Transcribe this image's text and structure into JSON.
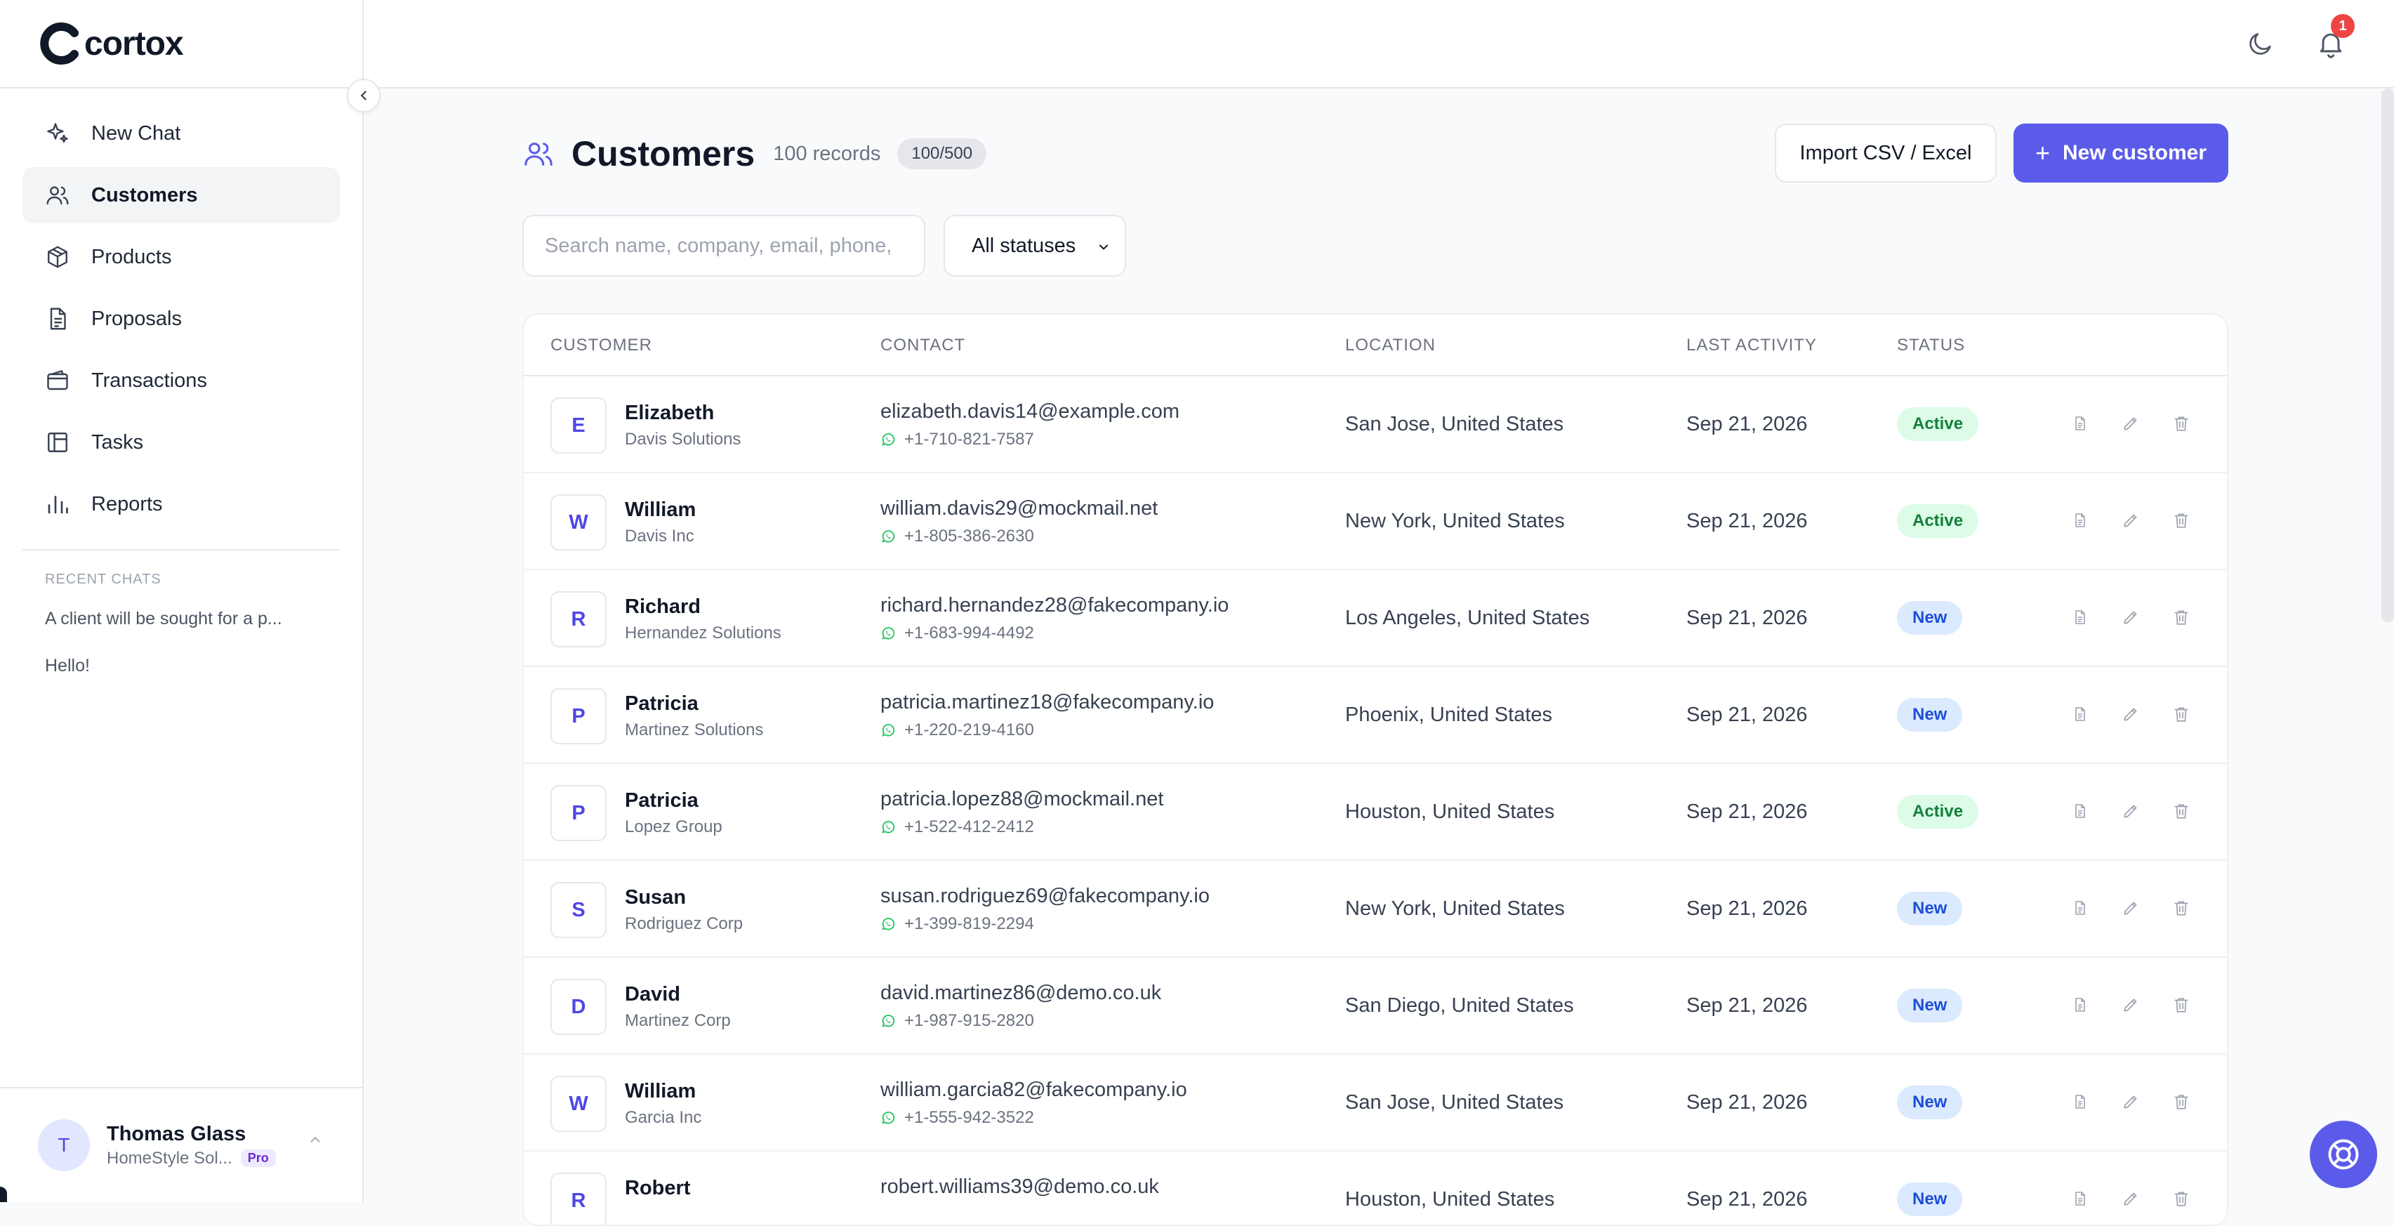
{
  "brand": {
    "name": "cortox"
  },
  "sidebar": {
    "items": [
      {
        "label": "New Chat",
        "icon": "sparkle-icon"
      },
      {
        "label": "Customers",
        "icon": "users-icon",
        "active": true
      },
      {
        "label": "Products",
        "icon": "box-icon"
      },
      {
        "label": "Proposals",
        "icon": "document-icon"
      },
      {
        "label": "Transactions",
        "icon": "wallet-icon"
      },
      {
        "label": "Tasks",
        "icon": "kanban-icon"
      },
      {
        "label": "Reports",
        "icon": "bar-chart-icon"
      }
    ],
    "recent_title": "RECENT CHATS",
    "recent_chats": [
      "A client will be sought for a p...",
      "Hello!"
    ]
  },
  "user": {
    "initial": "T",
    "name": "Thomas Glass",
    "org": "HomeStyle Sol...",
    "plan": "Pro"
  },
  "topbar": {
    "notification_count": "1"
  },
  "page": {
    "title": "Customers",
    "record_count": "100 records",
    "quota": "100/500",
    "import_label": "Import CSV / Excel",
    "new_label": "New customer"
  },
  "filters": {
    "search_placeholder": "Search name, company, email, phone,",
    "status_selected": "All statuses"
  },
  "table": {
    "headers": {
      "customer": "CUSTOMER",
      "contact": "CONTACT",
      "location": "LOCATION",
      "last_activity": "LAST ACTIVITY",
      "status": "STATUS"
    },
    "rows": [
      {
        "initial": "E",
        "name": "Elizabeth",
        "company": "Davis Solutions",
        "email": "elizabeth.davis14@example.com",
        "phone": "+1-710-821-7587",
        "location": "San Jose, United States",
        "activity": "Sep 21, 2026",
        "status": "Active"
      },
      {
        "initial": "W",
        "name": "William",
        "company": "Davis Inc",
        "email": "william.davis29@mockmail.net",
        "phone": "+1-805-386-2630",
        "location": "New York, United States",
        "activity": "Sep 21, 2026",
        "status": "Active"
      },
      {
        "initial": "R",
        "name": "Richard",
        "company": "Hernandez Solutions",
        "email": "richard.hernandez28@fakecompany.io",
        "phone": "+1-683-994-4492",
        "location": "Los Angeles, United States",
        "activity": "Sep 21, 2026",
        "status": "New"
      },
      {
        "initial": "P",
        "name": "Patricia",
        "company": "Martinez Solutions",
        "email": "patricia.martinez18@fakecompany.io",
        "phone": "+1-220-219-4160",
        "location": "Phoenix, United States",
        "activity": "Sep 21, 2026",
        "status": "New"
      },
      {
        "initial": "P",
        "name": "Patricia",
        "company": "Lopez Group",
        "email": "patricia.lopez88@mockmail.net",
        "phone": "+1-522-412-2412",
        "location": "Houston, United States",
        "activity": "Sep 21, 2026",
        "status": "Active"
      },
      {
        "initial": "S",
        "name": "Susan",
        "company": "Rodriguez Corp",
        "email": "susan.rodriguez69@fakecompany.io",
        "phone": "+1-399-819-2294",
        "location": "New York, United States",
        "activity": "Sep 21, 2026",
        "status": "New"
      },
      {
        "initial": "D",
        "name": "David",
        "company": "Martinez Corp",
        "email": "david.martinez86@demo.co.uk",
        "phone": "+1-987-915-2820",
        "location": "San Diego, United States",
        "activity": "Sep 21, 2026",
        "status": "New"
      },
      {
        "initial": "W",
        "name": "William",
        "company": "Garcia Inc",
        "email": "william.garcia82@fakecompany.io",
        "phone": "+1-555-942-3522",
        "location": "San Jose, United States",
        "activity": "Sep 21, 2026",
        "status": "New"
      },
      {
        "initial": "R",
        "name": "Robert",
        "company": "",
        "email": "robert.williams39@demo.co.uk",
        "phone": "",
        "location": "Houston, United States",
        "activity": "Sep 21, 2026",
        "status": "New"
      }
    ]
  },
  "colors": {
    "accent": "#5b5bea",
    "active_bg": "#dcfce7",
    "active_text": "#15803d",
    "new_bg": "#dbeafe",
    "new_text": "#1d4ed8",
    "notification": "#ef4444"
  }
}
